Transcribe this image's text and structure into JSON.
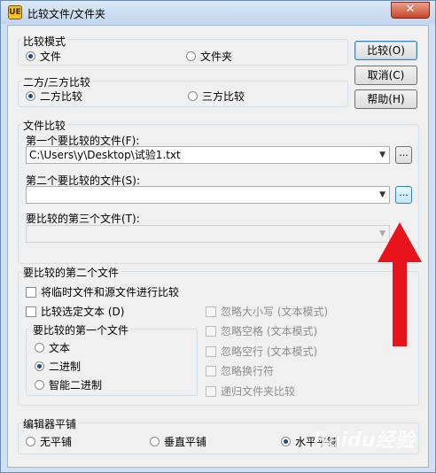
{
  "window": {
    "title": "比较文件/文件夹",
    "close_label": "✕"
  },
  "app_icon": "app-logo-icon",
  "compare_mode": {
    "label": "比较模式",
    "options": [
      "文件",
      "文件夹"
    ],
    "selected": "文件"
  },
  "two_three": {
    "label": "二方/三方比较",
    "options": [
      "二方比较",
      "三方比较"
    ],
    "selected": "二方比较"
  },
  "buttons": {
    "compare": "比较(O)",
    "cancel": "取消(C)",
    "help": "帮助(H)"
  },
  "file_compare": {
    "label": "文件比较",
    "first_label": "第一个要比较的文件(F):",
    "first_value": "C:\\Users\\y\\Desktop\\试验1.txt",
    "second_label": "第二个要比较的文件(S):",
    "second_value": "",
    "third_label": "要比较的第三个文件(T):",
    "third_value": "",
    "browse_label": "..."
  },
  "second_file_section": {
    "label": "要比较的第二个文件",
    "temp_compare": "将临时文件和源文件进行比较",
    "compare_selected": "比较选定文本 (D)",
    "first_file_group": {
      "label": "要比较的第一个文件",
      "options": [
        "文本",
        "二进制",
        "智能二进制"
      ],
      "selected": "二进制"
    },
    "ignore_options": [
      "忽略大小写 (文本模式)",
      "忽略空格 (文本模式)",
      "忽略空行 (文本模式)",
      "忽略换行符",
      "递归文件夹比较"
    ]
  },
  "editor_tile": {
    "label": "编辑器平铺",
    "options": [
      "无平铺",
      "垂直平铺",
      "水平平铺"
    ],
    "selected": "水平平铺"
  },
  "annotation": {
    "arrow_color": "#e8141c"
  },
  "watermark": "Baidu经验"
}
